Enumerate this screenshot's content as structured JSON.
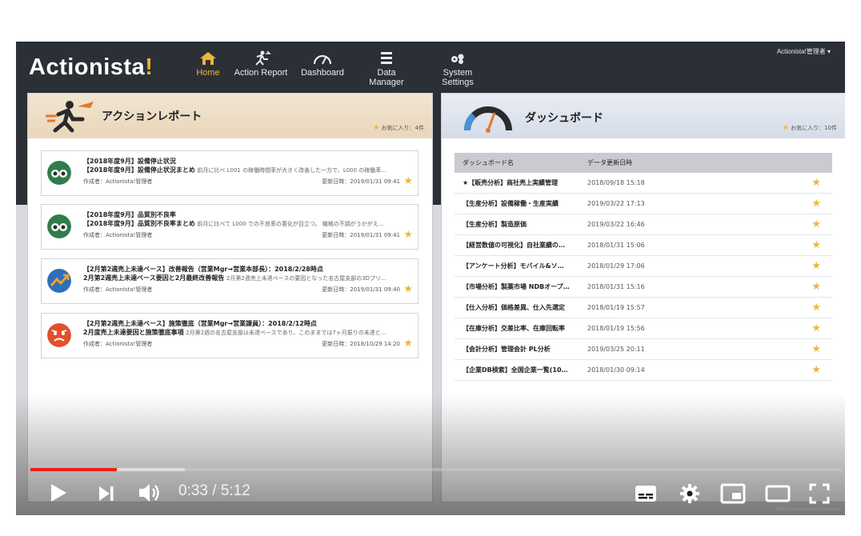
{
  "app": {
    "logo_main": "Actionista",
    "logo_bang": "!",
    "nav": [
      {
        "label": "Home",
        "icon": "home-icon",
        "active": true
      },
      {
        "label": "Action Report",
        "icon": "running-person-icon",
        "active": false
      },
      {
        "label": "Dashboard",
        "icon": "gauge-icon",
        "active": false
      },
      {
        "label": "Data Manager",
        "icon": "list-icon",
        "active": false
      },
      {
        "label": "System Settings",
        "icon": "gears-icon",
        "active": false
      }
    ],
    "user_menu": "Actionista!管理者 ▾"
  },
  "action_report": {
    "title": "アクションレポート",
    "favorites": "お気に入り：4件",
    "cards": [
      {
        "avatar": "binoculars-avatar",
        "line1": "【2018年度9月】設備停止状況",
        "line2_bold": "【2018年度9月】設備停止状況まとめ",
        "line2_rest": "前月に比べ L001 の稼働時間率が大きく改善した一方で、L000 の稼働率…",
        "author": "作成者：Actionista!管理者",
        "updated": "更新日時：2019/01/31 09:41"
      },
      {
        "avatar": "binoculars-avatar",
        "line1": "【2018年度9月】品質別不良率",
        "line2_bold": "【2018年度9月】品質別不良率まとめ",
        "line2_rest": "前月に比べて L000 での不良率の悪化が目立つ。 機械の不調がうかがえ…",
        "author": "作成者：Actionista!管理者",
        "updated": "更新日時：2019/01/31 09:41"
      },
      {
        "avatar": "trend-avatar",
        "line1": "【2月第2週売上未達ベース】改善報告（営業Mgr→営業本部長）：2018/2/28時点",
        "line2_bold": "2月第2週売上未達ベース要因と2月最終改善報告",
        "line2_rest": "2月第2週売上未達ベースの要因となった名古屋支部の3Dプリ…",
        "author": "作成者：Actionista!管理者",
        "updated": "更新日時：2019/01/31 09:40"
      },
      {
        "avatar": "angry-face-avatar",
        "line1": "【2月第2週売上未達ベース】施策徹底（営業Mgr→営業課員）：2018/2/12時点",
        "line2_bold": "2月度売上未達要因と施策徹底事項",
        "line2_rest": "2月第2週の名古屋支部は未達ベースであり、このままでは7ヶ月振りの未達と…",
        "author": "作成者：Actionista!管理者",
        "updated": "更新日時：2018/10/29 14:20"
      }
    ]
  },
  "dashboard": {
    "title": "ダッシュボード",
    "favorites": "お気に入り：10件",
    "col_name": "ダッシュボード名",
    "col_date": "データ更新日時",
    "rows": [
      {
        "name": "★【販売分析】商社売上実績管理",
        "date": "2018/09/18 15:18"
      },
      {
        "name": "【生産分析】設備稼働・生産実績",
        "date": "2019/03/22 17:13"
      },
      {
        "name": "【生産分析】製造原価",
        "date": "2019/03/22 16:46"
      },
      {
        "name": "【経営数値の可視化】自社業績の…",
        "date": "2018/01/31 15:06"
      },
      {
        "name": "【アンケート分析】モバイル&ソ…",
        "date": "2018/01/29 17:06"
      },
      {
        "name": "【市場分析】製薬市場 NDBオープ…",
        "date": "2018/01/31 15:16"
      },
      {
        "name": "【仕入分析】価格差異、仕入先選定",
        "date": "2018/01/19 15:57"
      },
      {
        "name": "【在庫分析】交差比率、在庫回転率",
        "date": "2018/01/19 15:56"
      },
      {
        "name": "【会計分析】管理会計 PL分析",
        "date": "2019/03/25 20:11"
      },
      {
        "name": "【企業DB検索】全国企業一覧(10…",
        "date": "2018/01/30 09:14"
      }
    ]
  },
  "player": {
    "time": "0:33 / 5:12",
    "progress": 0.107,
    "buffered": 0.19,
    "watermark": "©2019 JustSystems Corporation"
  }
}
